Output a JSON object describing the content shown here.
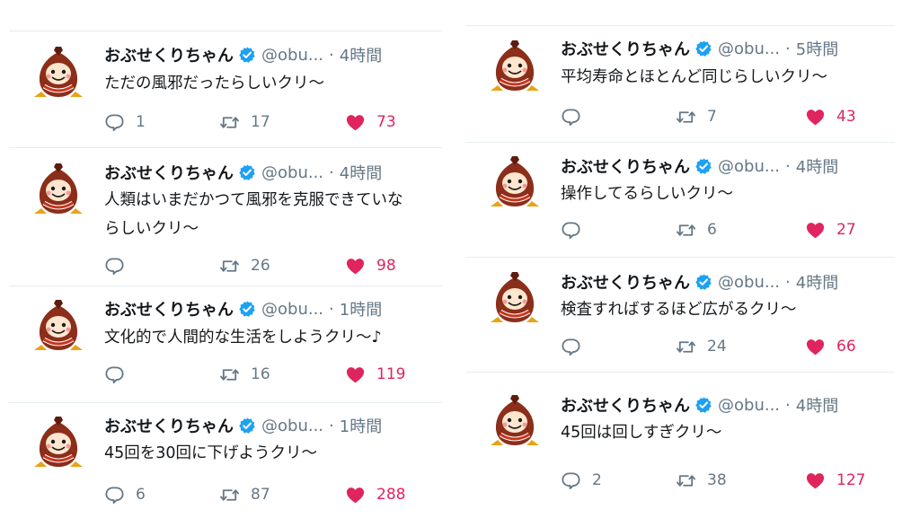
{
  "colors": {
    "like": "#e0245e",
    "verified": "#1da1f2",
    "meta": "#657786",
    "text": "#14171a",
    "divider": "#e6ecf0"
  },
  "icons": {
    "verified": "verified-badge-icon",
    "reply": "reply-icon",
    "retweet": "retweet-icon",
    "like": "heart-icon"
  },
  "left": [
    {
      "name": "おぶせくりちゃん",
      "handle": "@obu...",
      "dot": "·",
      "time": "4時間",
      "lines": [
        "ただの風邪だったらしいクリ〜"
      ],
      "replies": "1",
      "retweets": "17",
      "likes": "73"
    },
    {
      "name": "おぶせくりちゃん",
      "handle": "@obu...",
      "dot": "·",
      "time": "4時間",
      "lines": [
        "人類はいまだかつて風邪を克服できていな",
        "らしいクリ〜"
      ],
      "replies": "",
      "retweets": "26",
      "likes": "98"
    },
    {
      "name": "おぶせくりちゃん",
      "handle": "@obu...",
      "dot": "·",
      "time": "1時間",
      "lines": [
        "文化的で人間的な生活をしようクリ〜♪"
      ],
      "replies": "",
      "retweets": "16",
      "likes": "119"
    },
    {
      "name": "おぶせくりちゃん",
      "handle": "@obu...",
      "dot": "·",
      "time": "1時間",
      "lines": [
        "45回を30回に下げようクリ〜"
      ],
      "replies": "6",
      "retweets": "87",
      "likes": "288"
    }
  ],
  "right": [
    {
      "name": "おぶせくりちゃん",
      "handle": "@obu...",
      "dot": "·",
      "time": "5時間",
      "lines": [
        "平均寿命とほとんど同じらしいクリ〜"
      ],
      "replies": "",
      "retweets": "7",
      "likes": "43"
    },
    {
      "name": "おぶせくりちゃん",
      "handle": "@obu...",
      "dot": "·",
      "time": "4時間",
      "lines": [
        "操作してるらしいクリ〜"
      ],
      "replies": "",
      "retweets": "6",
      "likes": "27"
    },
    {
      "name": "おぶせくりちゃん",
      "handle": "@obu...",
      "dot": "·",
      "time": "4時間",
      "lines": [
        "検査すればするほど広がるクリ〜"
      ],
      "replies": "",
      "retweets": "24",
      "likes": "66"
    },
    {
      "name": "おぶせくりちゃん",
      "handle": "@obu...",
      "dot": "·",
      "time": "4時間",
      "lines": [
        "45回は回しすぎクリ〜"
      ],
      "replies": "2",
      "retweets": "38",
      "likes": "127"
    }
  ]
}
